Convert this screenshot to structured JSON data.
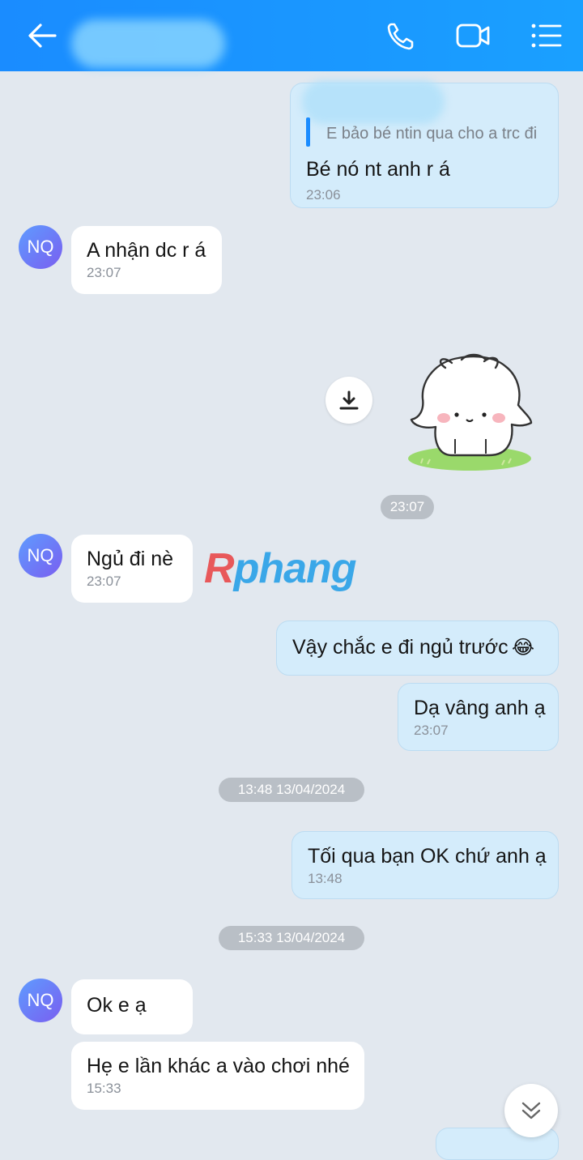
{
  "header": {
    "back_icon": "arrow-left-icon",
    "call_icon": "phone-icon",
    "video_icon": "video-camera-icon",
    "menu_icon": "list-menu-icon",
    "background_color": "#1a8cff"
  },
  "messages": {
    "m1": {
      "quote": "E bảo bé ntin qua cho a trc đi",
      "text": "Bé nó nt anh r á",
      "time": "23:06"
    },
    "m2": {
      "avatar": "NQ",
      "text": "A nhận dc r á",
      "time": "23:07"
    },
    "sticker_time": "23:07",
    "m3": {
      "avatar": "NQ",
      "text": "Ngủ đi nè",
      "time": "23:07"
    },
    "m4": {
      "text": "Vậy chắc e đi ngủ trước",
      "emoji": "😂"
    },
    "m5": {
      "text": "Dạ vâng anh ạ",
      "time": "23:07"
    },
    "divider1": "13:48 13/04/2024",
    "m6": {
      "text": "Tối qua bạn OK chứ anh ạ",
      "time": "13:48"
    },
    "divider2": "15:33 13/04/2024",
    "m7": {
      "avatar": "NQ",
      "text": "Ok e ạ"
    },
    "m8": {
      "text": "Hẹ e lần khác a vào chơi nhé",
      "time": "15:33"
    }
  },
  "watermark": {
    "first": "R",
    "rest": "phang"
  },
  "colors": {
    "outgoing_bubble": "#d4ecfb",
    "incoming_bubble": "#ffffff",
    "chat_background": "#e2e8ef"
  }
}
